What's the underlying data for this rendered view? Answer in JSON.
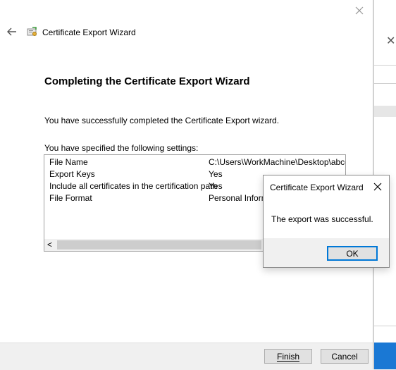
{
  "wizard": {
    "title": "Certificate Export Wizard",
    "heading": "Completing the Certificate Export Wizard",
    "success_message": "You have successfully completed the Certificate Export wizard.",
    "settings_intro": "You have specified the following settings:",
    "settings": [
      {
        "key": "File Name",
        "value": "C:\\Users\\WorkMachine\\Desktop\\abcof"
      },
      {
        "key": "Export Keys",
        "value": "Yes"
      },
      {
        "key": "Include all certificates in the certification path",
        "value": "Yes"
      },
      {
        "key": "File Format",
        "value": "Personal Informa"
      }
    ],
    "scroll_left_glyph": "<",
    "finish_label": "Finish",
    "cancel_label": "Cancel"
  },
  "dialog": {
    "title": "Certificate Export Wizard",
    "message": "The export was successful.",
    "ok_label": "OK"
  },
  "colors": {
    "accent": "#0078d7",
    "button_face": "#e1e1e1",
    "footer_bg": "#f0f0f0"
  },
  "icons": {
    "back": "back-arrow-icon",
    "wizard": "certificate-icon",
    "close": "close-icon"
  }
}
